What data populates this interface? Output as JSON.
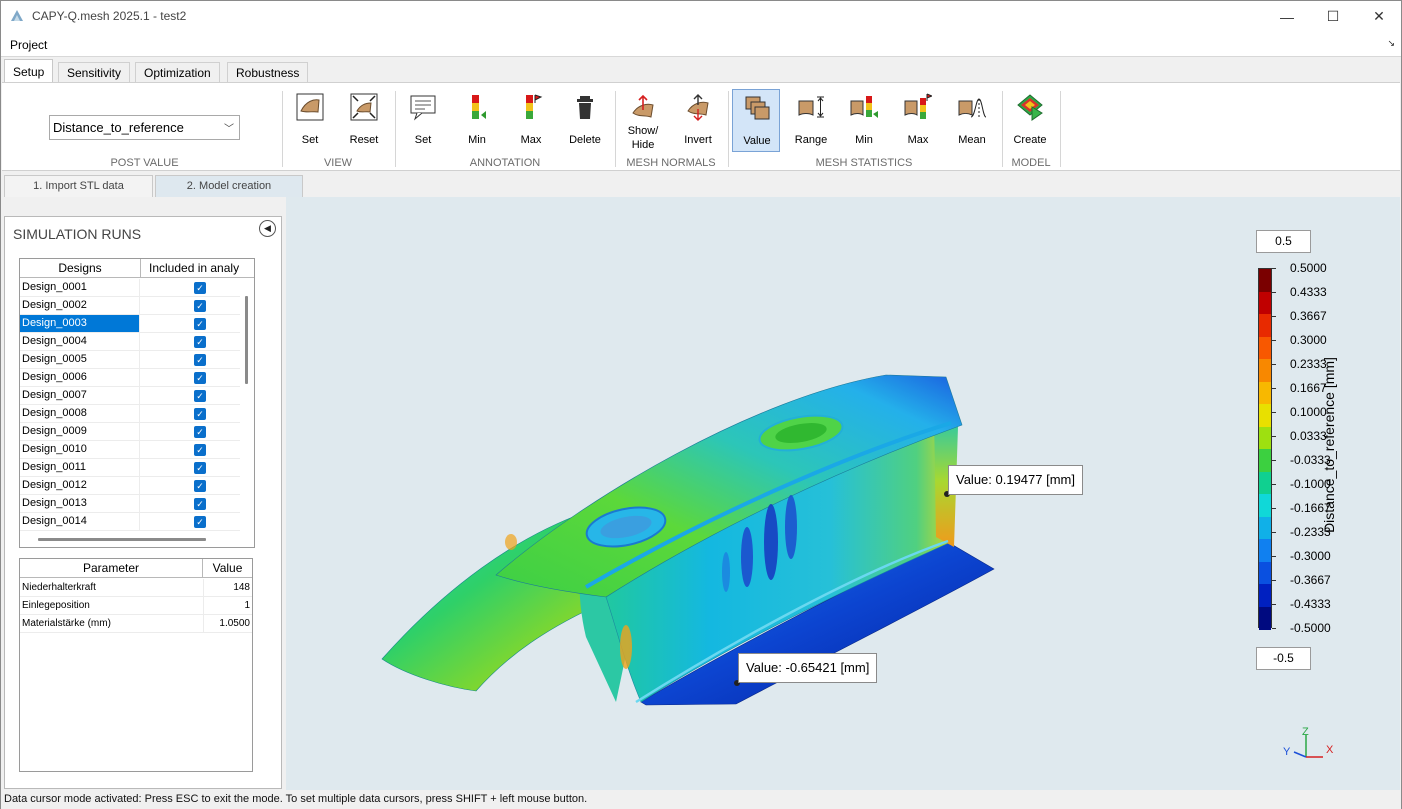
{
  "window": {
    "title": "CAPY-Q.mesh 2025.1 - test2",
    "minimize": "—",
    "maximize": "☐",
    "close": "✕"
  },
  "menu": {
    "project": "Project",
    "corner": "↘"
  },
  "ribbon_tabs": [
    "Setup",
    "Sensitivity",
    "Optimization",
    "Robustness"
  ],
  "post_value": {
    "selected": "Distance_to_reference",
    "group_label": "POST VALUE"
  },
  "ribbon_groups": {
    "view": {
      "label": "VIEW",
      "buttons": [
        "Set",
        "Reset"
      ]
    },
    "annotation": {
      "label": "ANNOTATION",
      "buttons": [
        "Set",
        "Min",
        "Max",
        "Delete"
      ]
    },
    "mesh_normals": {
      "label": "MESH NORMALS",
      "buttons": [
        "Show/\nHide",
        "Invert"
      ]
    },
    "mesh_statistics": {
      "label": "MESH STATISTICS",
      "buttons": [
        "Value",
        "Range",
        "Min",
        "Max",
        "Mean"
      ]
    },
    "model": {
      "label": "MODEL",
      "buttons": [
        "Create"
      ]
    }
  },
  "sub_tabs": [
    "1. Import STL data",
    "2. Model creation"
  ],
  "simulation_runs": {
    "title": "SIMULATION RUNS",
    "collapse": "◀",
    "columns": [
      "Designs",
      "Included in analy"
    ],
    "rows": [
      {
        "name": "Design_0001",
        "included": true
      },
      {
        "name": "Design_0002",
        "included": true
      },
      {
        "name": "Design_0003",
        "included": true
      },
      {
        "name": "Design_0004",
        "included": true
      },
      {
        "name": "Design_0005",
        "included": true
      },
      {
        "name": "Design_0006",
        "included": true
      },
      {
        "name": "Design_0007",
        "included": true
      },
      {
        "name": "Design_0008",
        "included": true
      },
      {
        "name": "Design_0009",
        "included": true
      },
      {
        "name": "Design_0010",
        "included": true
      },
      {
        "name": "Design_0011",
        "included": true
      },
      {
        "name": "Design_0012",
        "included": true
      },
      {
        "name": "Design_0013",
        "included": true
      },
      {
        "name": "Design_0014",
        "included": true
      }
    ],
    "selected_row": "Design_0003",
    "check_glyph": "✓"
  },
  "parameters": {
    "columns": [
      "Parameter",
      "Value"
    ],
    "rows": [
      {
        "name": "Niederhalterkraft",
        "value": "148"
      },
      {
        "name": "Einlegeposition",
        "value": "1"
      },
      {
        "name": "Materialstärke (mm)",
        "value": "1.0500"
      }
    ]
  },
  "colorbar": {
    "max_box": "0.5",
    "min_box": "-0.5",
    "title": "Distance_to_reference [mm]",
    "ticks": [
      "0.5000",
      "0.4333",
      "0.3667",
      "0.3000",
      "0.2333",
      "0.1667",
      "0.1000",
      "0.0333",
      "-0.0333",
      "-0.1000",
      "-0.1667",
      "-0.2333",
      "-0.3000",
      "-0.3667",
      "-0.4333",
      "-0.5000"
    ],
    "colors": [
      "#7a0000",
      "#c00000",
      "#e82a00",
      "#f85800",
      "#f88800",
      "#f8b800",
      "#e8e000",
      "#9ee010",
      "#3cd040",
      "#10d090",
      "#10d8d8",
      "#10b0e8",
      "#1080f0",
      "#0a50e0",
      "#0020c0",
      "#000a80"
    ]
  },
  "cursors": [
    {
      "label": "Value: 0.19477 [mm]"
    },
    {
      "label": "Value: -0.65421 [mm]"
    }
  ],
  "axis_triad": {
    "x": "X",
    "y": "Y",
    "z": "Z"
  },
  "status_text": "Data cursor mode activated: Press ESC to exit the mode. To set multiple data cursors, press SHIFT + left mouse button."
}
